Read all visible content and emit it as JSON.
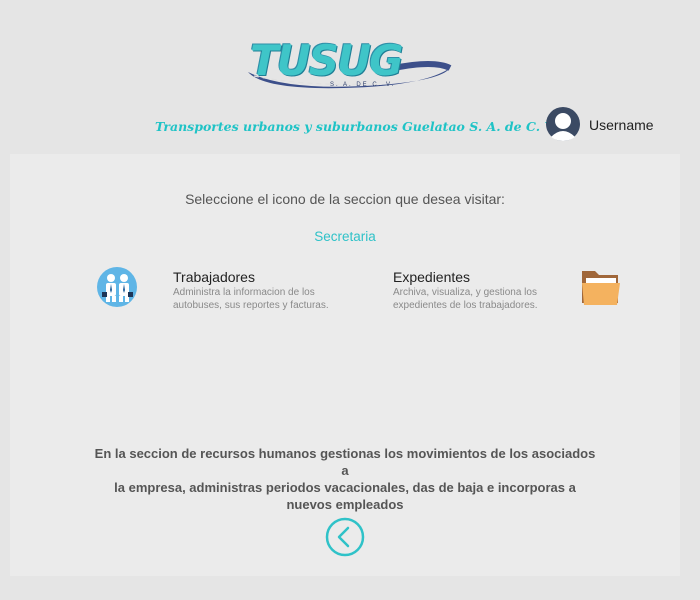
{
  "header": {
    "logo_text": "TUSUG",
    "logo_sub": "S. A. DE C. V.",
    "company_name": "Transportes urbanos y suburbanos Guelatao S. A. de C. V.",
    "username": "Username"
  },
  "main": {
    "instruction": "Seleccione el icono de la seccion que desea visitar:",
    "section_title": "Secretaria",
    "cards": [
      {
        "title": "Trabajadores",
        "desc_line1": "Administra la informacion de los",
        "desc_line2": "autobuses, sus reportes y facturas.",
        "icon": "workers-icon"
      },
      {
        "title": "Expedientes",
        "desc_line1": "Archiva, visualiza, y gestiona los",
        "desc_line2": "expedientes de los trabajadores.",
        "icon": "folder-icon"
      }
    ],
    "description_line1": "En la seccion de recursos humanos gestionas los movimientos de los asociados a",
    "description_line2": "la empresa, administras periodos vacacionales, das de baja e incorporas a",
    "description_line3": "nuevos empleados",
    "back_icon": "chevron-left-icon"
  },
  "colors": {
    "accent": "#2fc2c8",
    "background": "#e5e5e5",
    "panel": "#ebebeb"
  }
}
